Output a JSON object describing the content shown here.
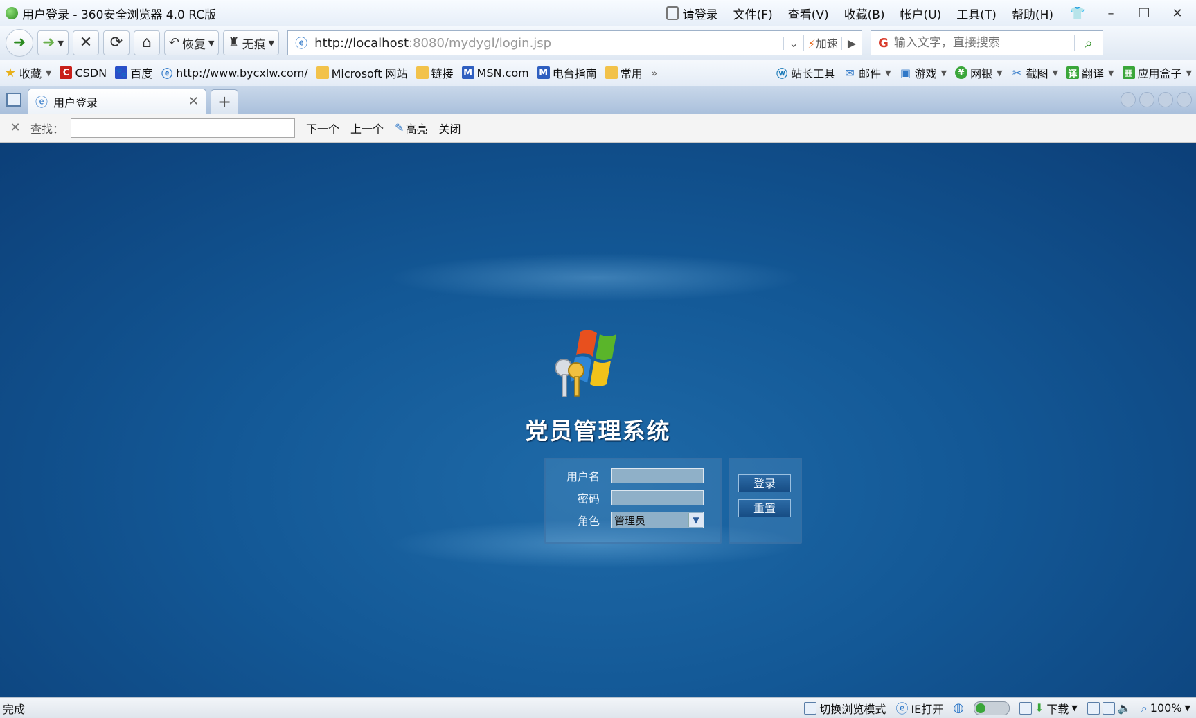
{
  "window": {
    "title": "用户登录 - 360安全浏览器 4.0 RC版",
    "login_prompt": "请登录",
    "menu": [
      "文件(F)",
      "查看(V)",
      "收藏(B)",
      "帐户(U)",
      "工具(T)",
      "帮助(H)"
    ]
  },
  "toolbar": {
    "restore_label": "恢复",
    "incognito_label": "无痕",
    "url_host": "http://localhost",
    "url_rest": ":8080/mydygl/login.jsp",
    "speed_label": "加速",
    "search_placeholder": "输入文字，直接搜索"
  },
  "favorites": {
    "items": [
      "收藏",
      "CSDN",
      "百度",
      "http://www.bycxlw.com/",
      "Microsoft 网站",
      "链接",
      "MSN.com",
      "电台指南",
      "常用"
    ],
    "overflow": "»",
    "right": [
      "站长工具",
      "邮件",
      "游戏",
      "网银",
      "截图",
      "翻译",
      "应用盒子"
    ]
  },
  "tabs": [
    {
      "label": "用户登录"
    }
  ],
  "findbar": {
    "label": "查找：",
    "next": "下一个",
    "prev": "上一个",
    "highlight": "高亮",
    "close": "关闭"
  },
  "login": {
    "system_title": "党员管理系统",
    "username_label": "用户名",
    "password_label": "密码",
    "role_label": "角色",
    "role_value": "管理员",
    "login_button": "登录",
    "reset_button": "重置"
  },
  "statusbar": {
    "status": "完成",
    "switch_mode": "切换浏览模式",
    "ie_open": "IE打开",
    "download": "下载",
    "zoom": "100%"
  },
  "colors": {
    "content_bg": "#135896",
    "panel_border": "#3c6ea0",
    "button_bg": "#174d85"
  }
}
